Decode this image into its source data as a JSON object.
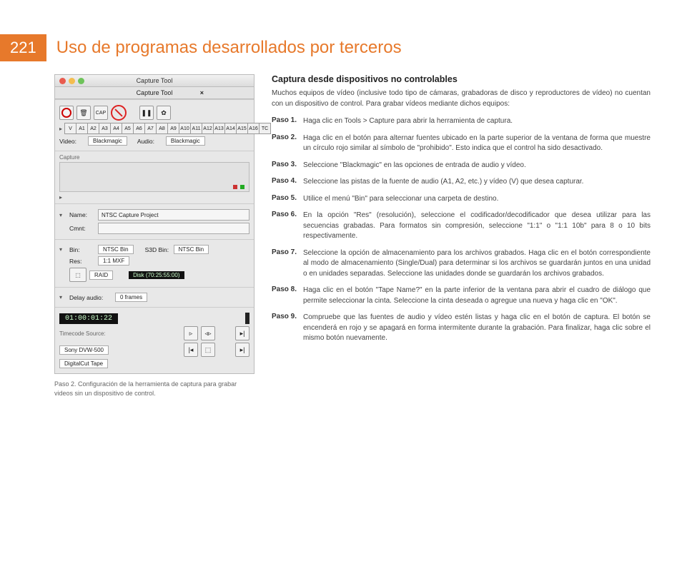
{
  "page_number": "221",
  "title": "Uso de programas desarrollados por terceros",
  "caption": "Paso 2. Configuración de la herramienta de captura para grabar videos sin un dispositivo de control.",
  "section_title": "Captura desde dispositivos no controlables",
  "intro": "Muchos equipos de vídeo (inclusive todo tipo de cámaras, grabadoras de disco y reproductores de vídeo) no cuentan con un dispositivo de control. Para grabar vídeos mediante dichos equipos:",
  "steps": [
    {
      "label": "Paso 1.",
      "text": "Haga clic en Tools > Capture para abrir la herramienta de captura."
    },
    {
      "label": "Paso 2.",
      "text": "Haga clic en el botón para alternar fuentes ubicado en la parte superior de la ventana de forma que muestre un círculo rojo similar al símbolo de \"prohibido\". Esto indica que el control ha sido desactivado."
    },
    {
      "label": "Paso 3.",
      "text": "Seleccione \"Blackmagic\" en las opciones de entrada de audio y vídeo."
    },
    {
      "label": "Paso 4.",
      "text": "Seleccione las pistas de la fuente de audio (A1, A2, etc.) y vídeo (V) que desea capturar."
    },
    {
      "label": "Paso 5.",
      "text": "Utilice el menú \"Bin\" para seleccionar una carpeta de destino."
    },
    {
      "label": "Paso 6.",
      "text": "En la opción \"Res\" (resolución), seleccione el codificador/decodificador que desea utilizar para las secuencias grabadas. Para formatos sin compresión, seleccione \"1:1\" o \"1:1 10b\" para 8 o 10 bits respectivamente."
    },
    {
      "label": "Paso 7.",
      "text": "Seleccione la opción de almacenamiento para los archivos grabados. Haga clic en el botón correspondiente al modo de almacenamiento (Single/Dual) para determinar si los archivos se guardarán juntos en una unidad o en unidades separadas. Seleccione las unidades donde se guardarán los archivos grabados."
    },
    {
      "label": "Paso 8.",
      "text": "Haga clic en el botón \"Tape Name?\" en la parte inferior de la ventana para abrir el cuadro de diálogo que permite seleccionar la cinta.  Seleccione la cinta deseada o agregue una nueva y haga clic en \"OK\"."
    },
    {
      "label": "Paso 9.",
      "text": "Compruebe que las fuentes de audio y vídeo estén listas y haga clic en el botón de captura. El botón se encenderá en rojo y se apagará en forma intermitente durante la grabación. Para finalizar, haga clic sobre el mismo botón nuevamente."
    }
  ],
  "win": {
    "title": "Capture Tool",
    "subtitle": "Capture Tool",
    "close": "×",
    "tracks": [
      "V",
      "A1",
      "A2",
      "A3",
      "A4",
      "A5",
      "A6",
      "A7",
      "A8",
      "A9",
      "A10",
      "A11",
      "A12",
      "A13",
      "A14",
      "A15",
      "A16",
      "TC"
    ],
    "video_label": "Video:",
    "video_value": "Blackmagic",
    "audio_label": "Audio:",
    "audio_value": "Blackmagic",
    "capture_label": "Capture",
    "name_label": "Name:",
    "name_value": "NTSC Capture Project",
    "cmnt_label": "Cmnt:",
    "bin_label": "Bin:",
    "bin_value": "NTSC Bin",
    "s3d_label": "S3D Bin:",
    "s3d_value": "NTSC Bin",
    "res_label": "Res:",
    "res_value": "1:1 MXF",
    "raid_label": "RAID",
    "disk_value": "Disk (70:25:55:00)",
    "delay_label": "Delay audio:",
    "delay_value": "0 frames",
    "timecode": "01:00:01:22",
    "tcsrc_label": "Timecode Source:",
    "tcsrc_value": "Sony DVW-500",
    "tape": "DigitalCut Tape"
  }
}
